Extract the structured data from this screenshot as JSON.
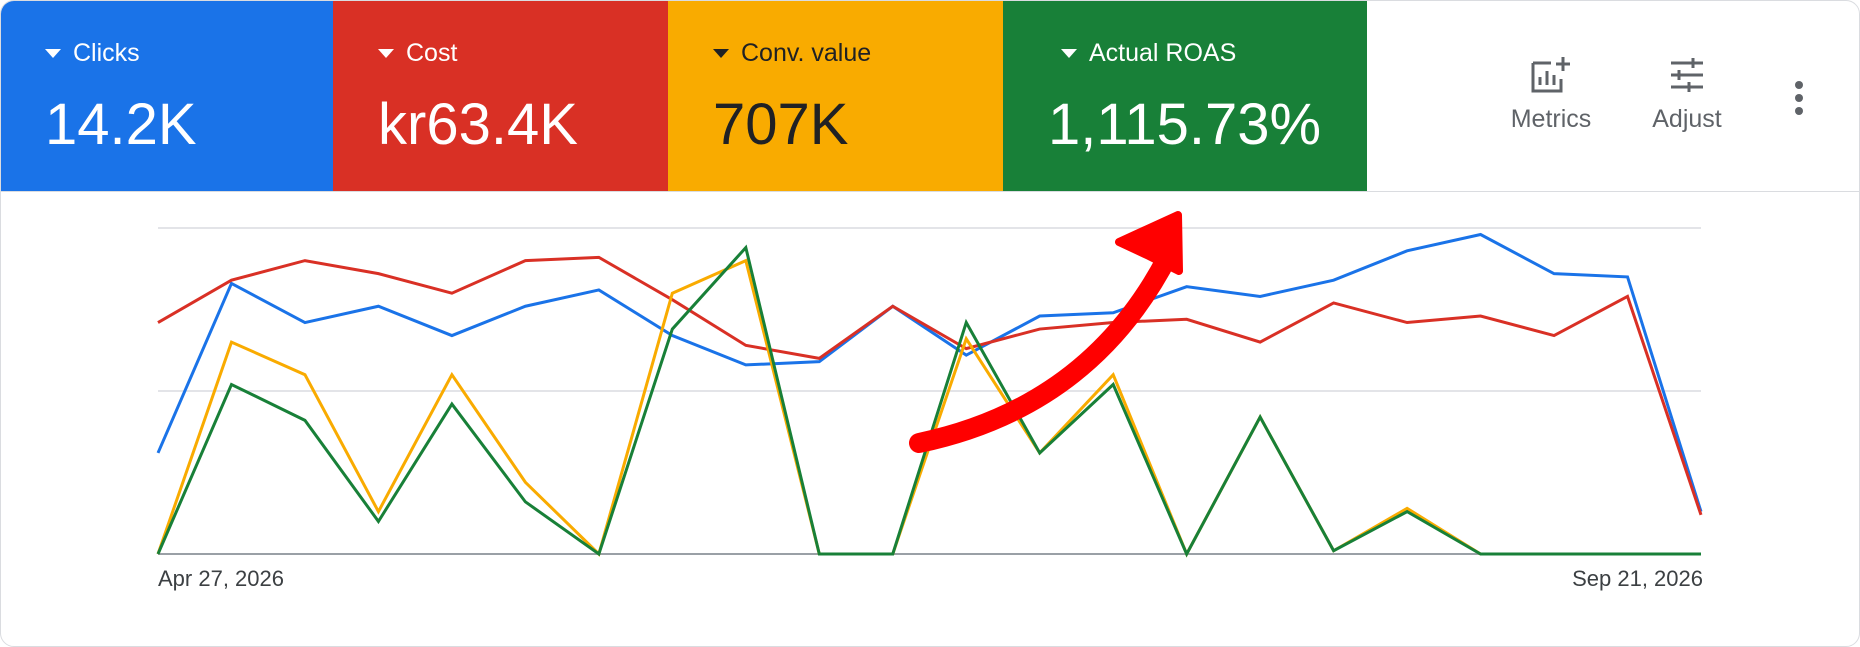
{
  "scorecards": [
    {
      "label": "Clicks",
      "value": "14.2K",
      "color": "#1a73e8",
      "text_color": "#ffffff"
    },
    {
      "label": "Cost",
      "value": "kr63.4K",
      "color": "#d93025",
      "text_color": "#ffffff"
    },
    {
      "label": "Conv. value",
      "value": "707K",
      "color": "#f9ab00",
      "text_color": "#202124"
    },
    {
      "label": "Actual ROAS",
      "value": "1,115.73%",
      "color": "#188038",
      "text_color": "#ffffff"
    }
  ],
  "toolbar": {
    "metrics_label": "Metrics",
    "adjust_label": "Adjust"
  },
  "annotation_color": "#ff0000",
  "chart_data": {
    "type": "line",
    "x": [
      "Apr 27, 2026",
      "May 4, 2026",
      "May 11, 2026",
      "May 18, 2026",
      "May 25, 2026",
      "Jun 1, 2026",
      "Jun 8, 2026",
      "Jun 15, 2026",
      "Jun 22, 2026",
      "Jun 29, 2026",
      "Jul 6, 2026",
      "Jul 13, 2026",
      "Jul 20, 2026",
      "Jul 27, 2026",
      "Aug 3, 2026",
      "Aug 10, 2026",
      "Aug 17, 2026",
      "Aug 24, 2026",
      "Aug 31, 2026",
      "Sep 7, 2026",
      "Sep 14, 2026",
      "Sep 21, 2026"
    ],
    "x_tick_labels": [
      "Apr 27, 2026",
      "Sep 21, 2026"
    ],
    "ylim": [
      0,
      100
    ],
    "gridlines": [
      50,
      100
    ],
    "series": [
      {
        "color": "#1a73e8",
        "values": [
          31,
          83,
          71,
          76,
          67,
          76,
          81,
          67,
          58,
          59,
          76,
          61,
          73,
          74,
          82,
          79,
          84,
          93,
          98,
          86,
          85,
          13
        ]
      },
      {
        "color": "#d93025",
        "values": [
          71,
          84,
          90,
          86,
          80,
          90,
          91,
          78,
          64,
          60,
          76,
          63,
          69,
          71,
          72,
          65,
          77,
          71,
          73,
          67,
          79,
          12
        ]
      },
      {
        "color": "#f9ab00",
        "values": [
          0,
          65,
          55,
          13,
          55,
          22,
          0,
          80,
          90,
          0,
          0,
          66,
          31,
          55,
          0,
          42,
          1,
          14,
          0,
          0,
          0,
          0
        ]
      },
      {
        "color": "#188038",
        "values": [
          0,
          52,
          41,
          10,
          46,
          16,
          0,
          69,
          94,
          0,
          0,
          71,
          31,
          52,
          0,
          42,
          1,
          13,
          0,
          0,
          0,
          0
        ]
      }
    ]
  }
}
